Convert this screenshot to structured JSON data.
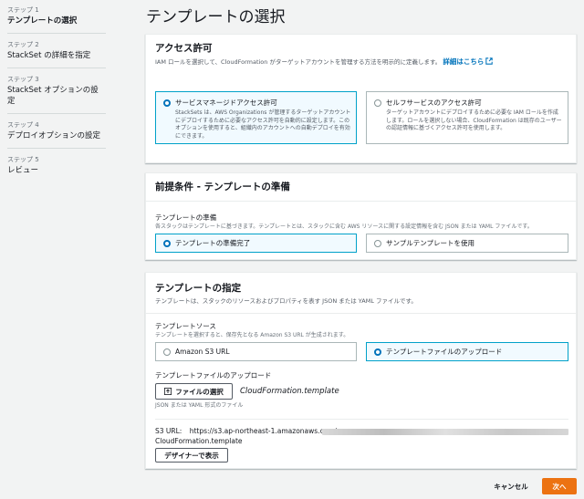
{
  "steps": [
    {
      "num": "ステップ 1",
      "name": "テンプレートの選択"
    },
    {
      "num": "ステップ 2",
      "name": "StackSet の詳細を指定"
    },
    {
      "num": "ステップ 3",
      "name": "StackSet オプションの設定"
    },
    {
      "num": "ステップ 4",
      "name": "デプロイオプションの設定"
    },
    {
      "num": "ステップ 5",
      "name": "レビュー"
    }
  ],
  "page_title": "テンプレートの選択",
  "permissions": {
    "title": "アクセス許可",
    "desc": "IAM ロールを選択して、CloudFormation がターゲットアカウントを管理する方法を明示的に定義します。",
    "link": "詳細はこちら",
    "options": [
      {
        "label": "サービスマネージドアクセス許可",
        "desc": "StackSets は、AWS Organizations が管理するターゲットアカウントにデプロイするために必要なアクセス許可を自動的に設定します。このオプションを使用すると、組織内のアカウントへの自動デプロイを有効にできます。",
        "selected": true
      },
      {
        "label": "セルフサービスのアクセス許可",
        "desc": "ターゲットアカウントにデプロイするために必要な IAM ロールを作成します。ロールを選択しない場合、CloudFormation は既存のユーザーの認証情報に基づくアクセス許可を使用します。",
        "selected": false
      }
    ]
  },
  "prereq": {
    "title": "前提条件 - テンプレートの準備",
    "field_label": "テンプレートの準備",
    "field_desc": "各スタックはテンプレートに基づきます。テンプレートとは、スタックに含む AWS リソースに関する設定情報を含む JSON または YAML ファイルです。",
    "options": [
      {
        "label": "テンプレートの準備完了",
        "selected": true
      },
      {
        "label": "サンプルテンプレートを使用",
        "selected": false
      }
    ]
  },
  "spec": {
    "title": "テンプレートの指定",
    "desc": "テンプレートは、スタックのリソースおよびプロパティを表す JSON または YAML ファイルです。",
    "source_label": "テンプレートソース",
    "source_desc": "テンプレートを選択すると、保存先となる Amazon S3 URL が生成されます。",
    "options": [
      {
        "label": "Amazon S3 URL",
        "selected": false
      },
      {
        "label": "テンプレートファイルのアップロード",
        "selected": true
      }
    ],
    "upload_label": "テンプレートファイルのアップロード",
    "choose_file": "ファイルの選択",
    "filename": "CloudFormation.template",
    "file_hint": "JSON または YAML 形式のファイル",
    "s3_label": "S3 URL:",
    "s3_url": "https://s3.ap-northeast-1.amazonaws.com/",
    "s3_file": "CloudFormation.template",
    "designer_button": "デザイナーで表示"
  },
  "footer": {
    "cancel": "キャンセル",
    "next": "次へ"
  },
  "colors": {
    "accent": "#0073bb",
    "primary": "#ec7211",
    "selected_border": "#00a1c9"
  }
}
